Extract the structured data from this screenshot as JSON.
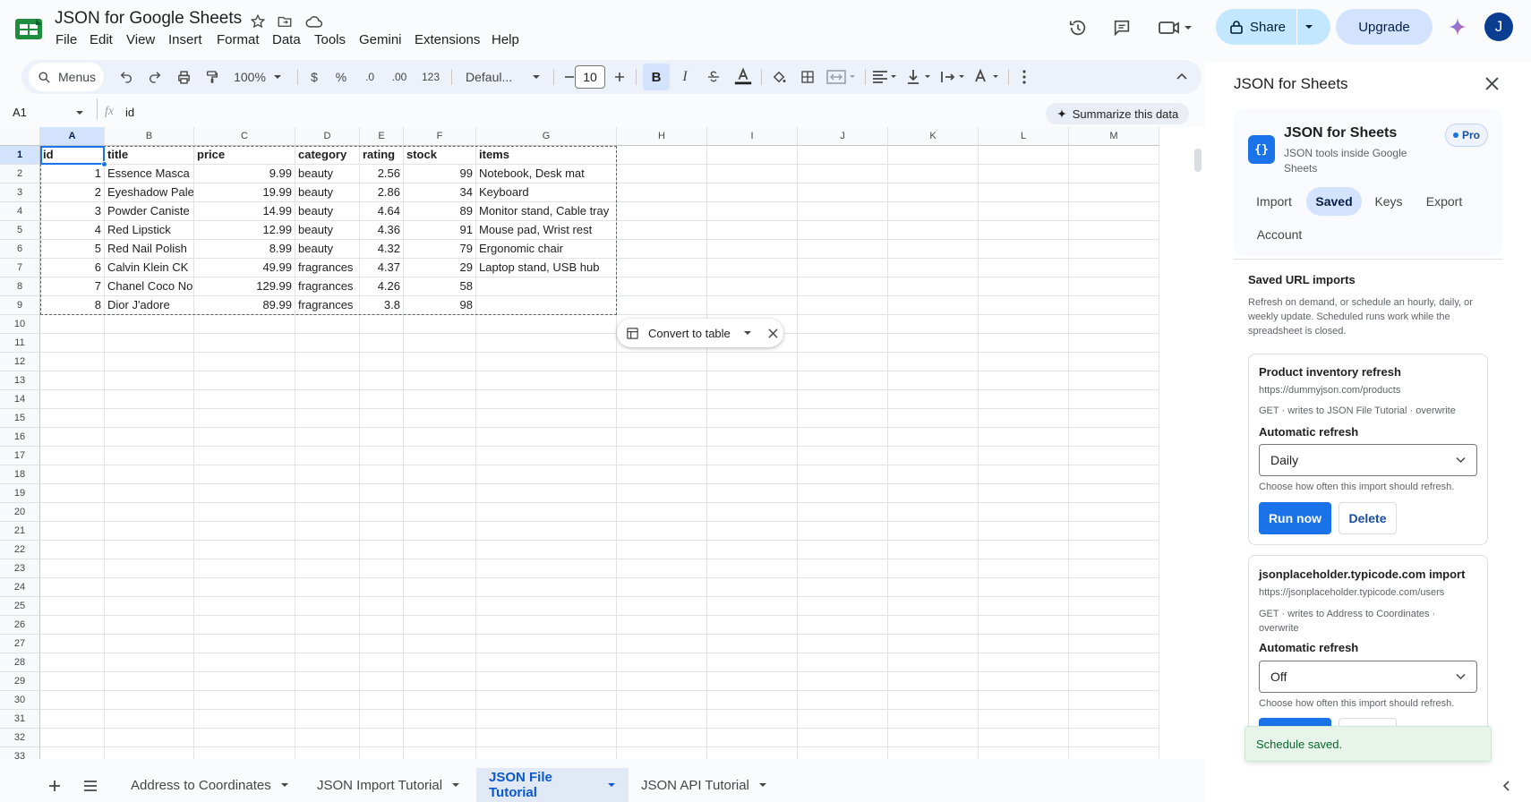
{
  "app": {
    "title": "JSON for Google Sheets"
  },
  "menus": [
    "File",
    "Edit",
    "View",
    "Insert",
    "Format",
    "Data",
    "Tools",
    "Gemini",
    "Extensions",
    "Help"
  ],
  "header": {
    "share_label": "Share",
    "upgrade_label": "Upgrade",
    "avatar_letter": "J"
  },
  "toolbar": {
    "search_label": "Menus",
    "zoom": "100%",
    "currency": "$",
    "percent": "%",
    "dec_dec": ".0",
    "dec_inc": ".00",
    "number_format": "123",
    "font": "Defaul...",
    "font_size": "10",
    "bold": "B",
    "italic": "I"
  },
  "formula": {
    "cell_ref": "A1",
    "fx": "fx",
    "value": "id",
    "summarize_label": "Summarize this data"
  },
  "grid": {
    "columns": [
      "A",
      "B",
      "C",
      "D",
      "E",
      "F",
      "G",
      "H",
      "I",
      "J",
      "K",
      "L",
      "M"
    ],
    "rows": [
      "1",
      "2",
      "3",
      "4",
      "5",
      "6",
      "7",
      "8",
      "9",
      "10",
      "11",
      "12",
      "13",
      "14",
      "15",
      "16",
      "17",
      "18",
      "19",
      "20",
      "21",
      "22",
      "23",
      "24",
      "25",
      "26",
      "27",
      "28",
      "29",
      "30",
      "31",
      "32",
      "33"
    ],
    "header_row": [
      "id",
      "title",
      "price",
      "category",
      "rating",
      "stock",
      "items"
    ],
    "data": [
      [
        "1",
        "Essence Masca",
        "9.99",
        "beauty",
        "2.56",
        "99",
        "Notebook, Desk mat"
      ],
      [
        "2",
        "Eyeshadow Pale",
        "19.99",
        "beauty",
        "2.86",
        "34",
        "Keyboard"
      ],
      [
        "3",
        "Powder Caniste",
        "14.99",
        "beauty",
        "4.64",
        "89",
        "Monitor stand, Cable tray"
      ],
      [
        "4",
        "Red Lipstick",
        "12.99",
        "beauty",
        "4.36",
        "91",
        "Mouse pad, Wrist rest"
      ],
      [
        "5",
        "Red Nail Polish",
        "8.99",
        "beauty",
        "4.32",
        "79",
        "Ergonomic chair"
      ],
      [
        "6",
        "Calvin Klein CK",
        "49.99",
        "fragrances",
        "4.37",
        "29",
        "Laptop stand, USB hub"
      ],
      [
        "7",
        "Chanel Coco No",
        "129.99",
        "fragrances",
        "4.26",
        "58",
        ""
      ],
      [
        "8",
        "Dior J'adore",
        "89.99",
        "fragrances",
        "3.8",
        "98",
        ""
      ]
    ],
    "convert_label": "Convert to table"
  },
  "sheets": {
    "tabs": [
      "Address to Coordinates",
      "JSON Import Tutorial",
      "JSON File Tutorial",
      "JSON API Tutorial"
    ],
    "active_index": 2
  },
  "panel": {
    "title": "JSON for Sheets",
    "app_name": "JSON for Sheets",
    "app_desc": "JSON tools inside Google Sheets",
    "badge": "Pro",
    "tabs": [
      "Import",
      "Saved",
      "Keys",
      "Export",
      "Account"
    ],
    "active_tab": "Saved",
    "section_title": "Saved URL imports",
    "section_desc": "Refresh on demand, or schedule an hourly, daily, or weekly update. Scheduled runs work while the spreadsheet is closed.",
    "imports": [
      {
        "name": "Product inventory refresh",
        "url": "https://dummyjson.com/products",
        "meta": "GET · writes to JSON File Tutorial · overwrite",
        "refresh_label": "Automatic refresh",
        "refresh_value": "Daily",
        "hint": "Choose how often this import should refresh.",
        "run_label": "Run now",
        "delete_label": "Delete"
      },
      {
        "name": "jsonplaceholder.typicode.com import",
        "url": "https://jsonplaceholder.typicode.com/users",
        "meta": "GET · writes to Address to Coordinates · overwrite",
        "refresh_label": "Automatic refresh",
        "refresh_value": "Off",
        "hint": "Choose how often this import should refresh."
      }
    ],
    "toast": "Schedule saved."
  },
  "colors": {
    "accent": "#1a73e8",
    "selected": "#d3e3fd",
    "toolbar": "#edf2fa"
  }
}
